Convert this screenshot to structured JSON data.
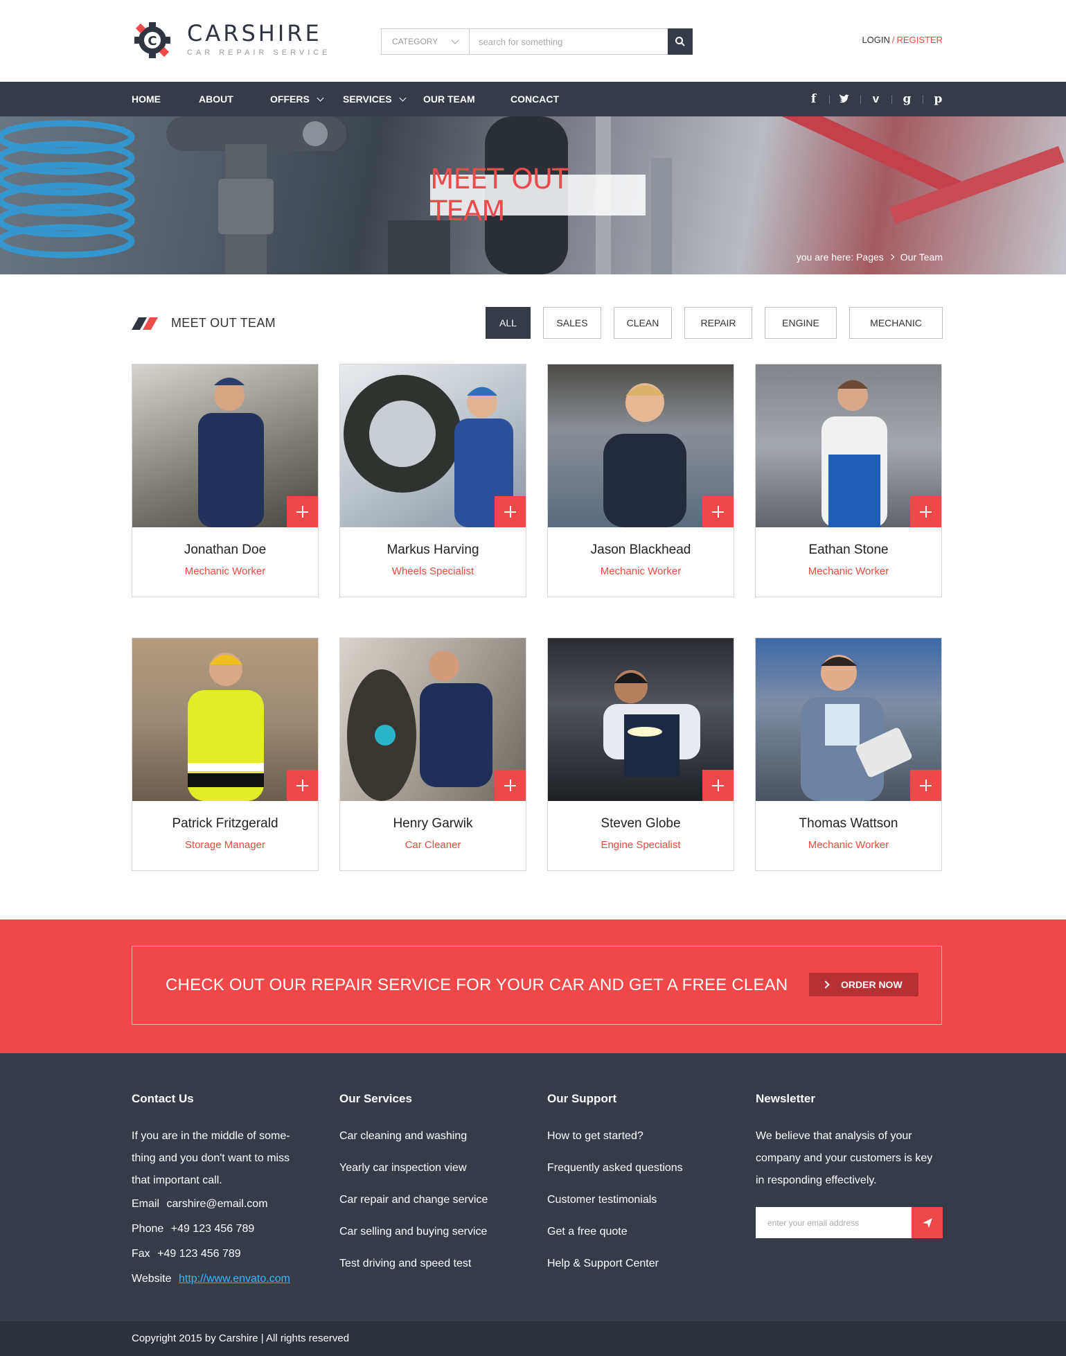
{
  "header": {
    "logo_name": "CARSHIRE",
    "logo_tagline": "CAR REPAIR SERVICE",
    "logo_letter": "C",
    "search_category": "CATEGORY",
    "search_placeholder": "search for something",
    "login": "LOGIN",
    "divider": "/",
    "register": "REGISTER"
  },
  "nav": {
    "items": [
      {
        "label": "HOME"
      },
      {
        "label": "ABOUT"
      },
      {
        "label": "OFFERS"
      },
      {
        "label": "SERVICES"
      },
      {
        "label": "OUR TEAM"
      },
      {
        "label": "CONCACT"
      }
    ],
    "social": [
      "f",
      "t",
      "v",
      "g",
      "p"
    ]
  },
  "hero": {
    "title": "MEET OUT TEAM",
    "breadcrumb_prefix": "you are here: Pages",
    "breadcrumb_current": "Our Team"
  },
  "section": {
    "title": "MEET OUT TEAM",
    "filters": [
      "ALL",
      "SALES",
      "CLEAN",
      "REPAIR",
      "ENGINE",
      "MECHANIC"
    ]
  },
  "team": [
    {
      "name": "Jonathan Doe",
      "role": "Mechanic Worker"
    },
    {
      "name": "Markus Harving",
      "role": "Wheels Specialist"
    },
    {
      "name": "Jason Blackhead",
      "role": "Mechanic Worker"
    },
    {
      "name": "Eathan Stone",
      "role": "Mechanic Worker"
    },
    {
      "name": "Patrick Fritzgerald",
      "role": "Storage Manager"
    },
    {
      "name": "Henry Garwik",
      "role": "Car Cleaner"
    },
    {
      "name": "Steven Globe",
      "role": "Engine Specialist"
    },
    {
      "name": "Thomas Wattson",
      "role": "Mechanic Worker"
    }
  ],
  "cta": {
    "text": "CHECK OUT OUR REPAIR SERVICE FOR YOUR CAR AND GET A FREE CLEAN",
    "button": "ORDER NOW"
  },
  "footer": {
    "contact": {
      "title": "Contact Us",
      "intro_lines": [
        "If you are in the middle of some-",
        "thing and you don't want to miss",
        "that important call."
      ],
      "email_label": "Email",
      "email": "carshire@email.com",
      "phone_label": "Phone",
      "phone": "+49 123 456 789",
      "fax_label": "Fax",
      "fax": "+49 123 456 789",
      "website_label": "Website",
      "website": "http://www.envato.com"
    },
    "services": {
      "title": "Our Services",
      "links": [
        "Car cleaning and washing",
        "Yearly car inspection view",
        "Car repair and change service",
        "Car selling and buying service",
        "Test driving and speed test"
      ]
    },
    "support": {
      "title": "Our Support",
      "links": [
        "How to get started?",
        "Frequently asked questions",
        "Customer testimonials",
        "Get a free quote",
        "Help & Support Center"
      ]
    },
    "newsletter": {
      "title": "Newsletter",
      "lines": [
        "We believe that analysis of your",
        "company and your customers is key",
        "in responding effectively."
      ],
      "placeholder": "enter your email address"
    },
    "copyright": "Copyright 2015 by Carshire | All rights reserved"
  },
  "colors": {
    "accent": "#f04848",
    "dark": "#353c48"
  }
}
